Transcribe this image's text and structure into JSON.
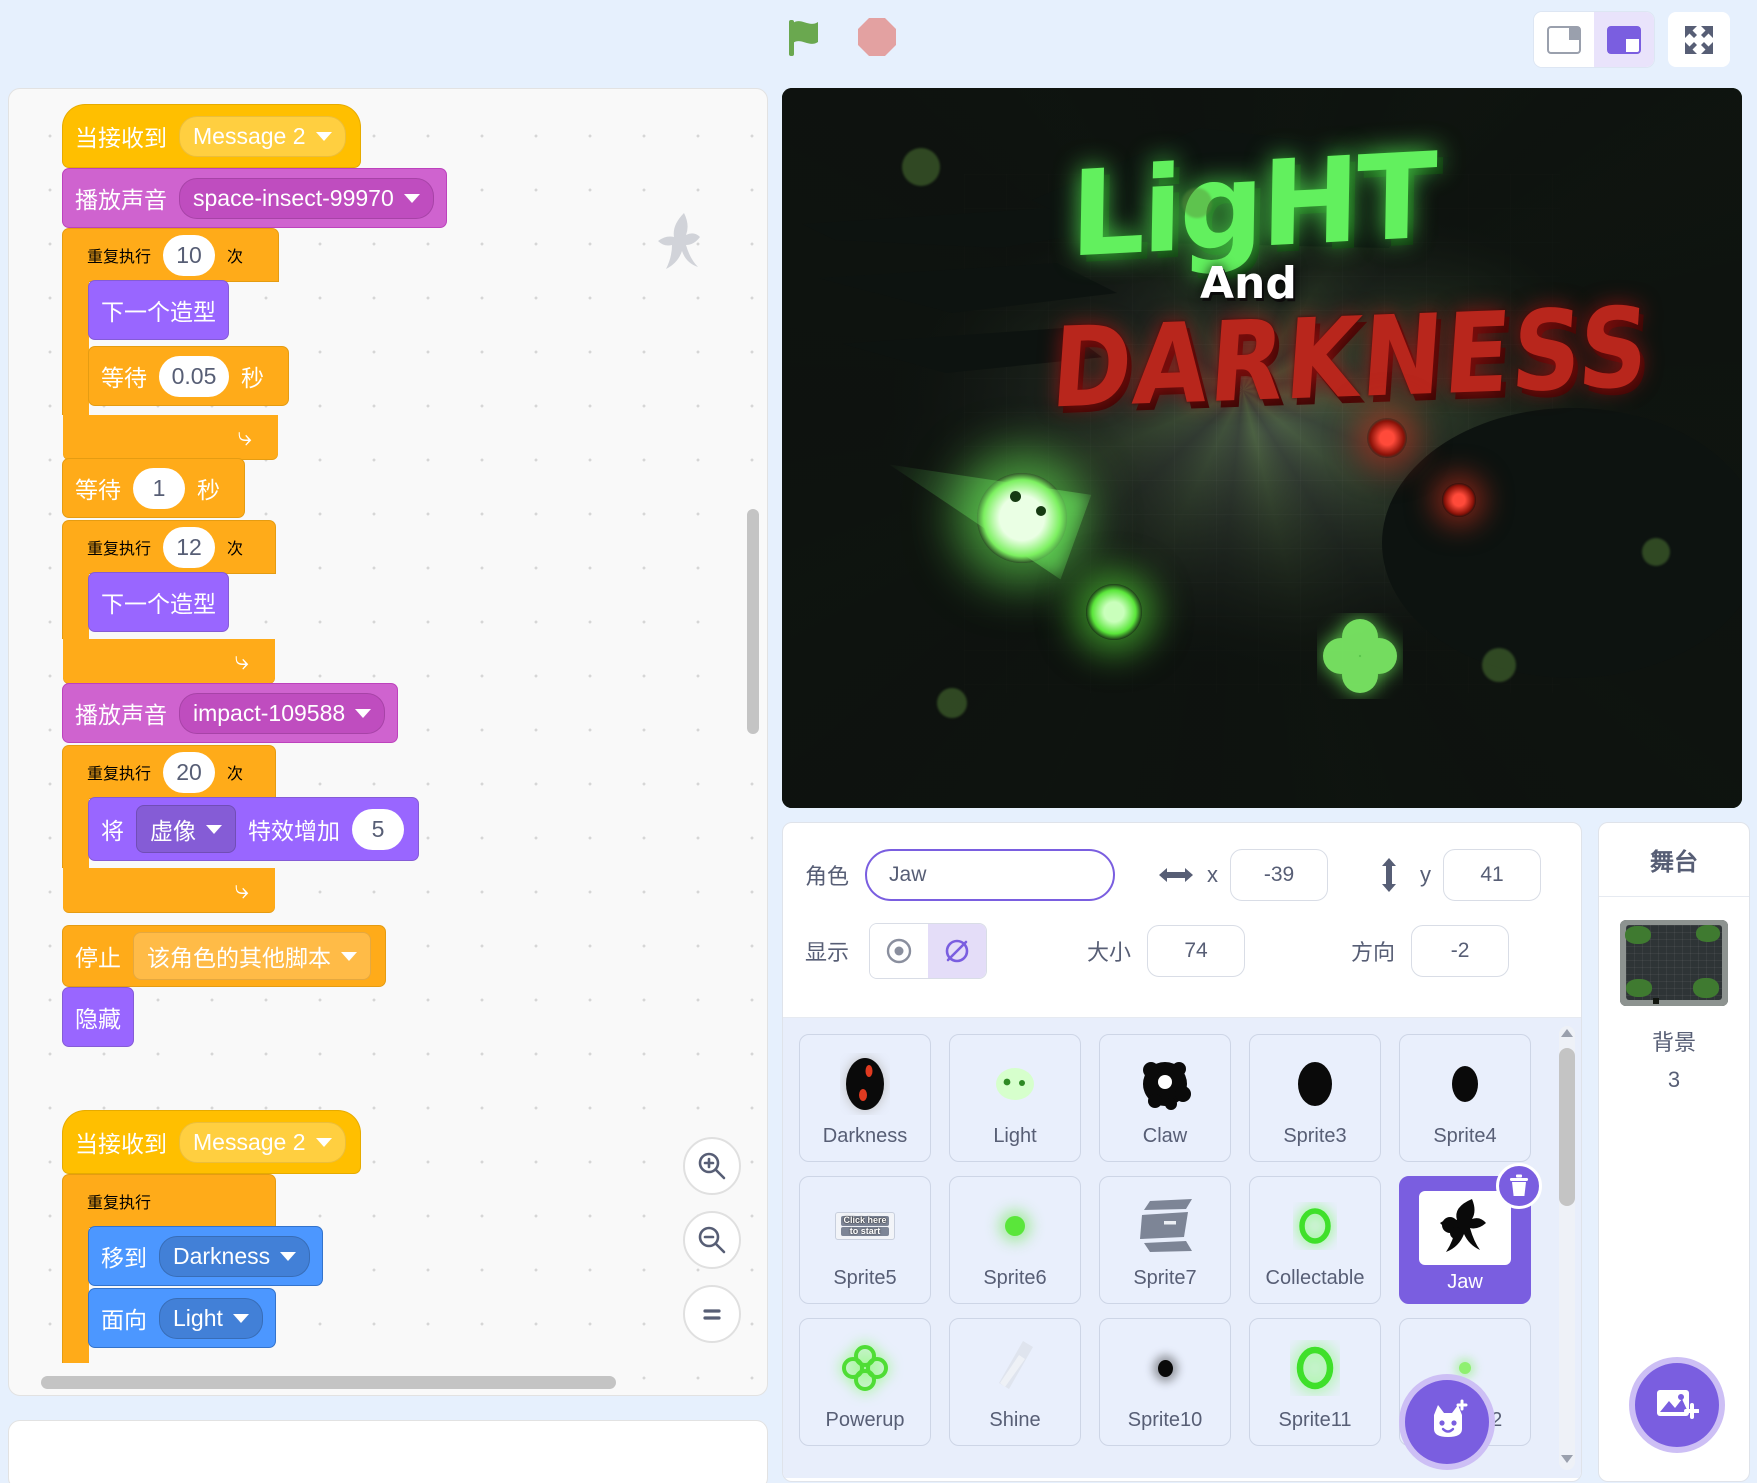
{
  "toolbar": {
    "green_flag": "green-flag",
    "stop": "stop-sign",
    "small_stage": "small-stage-layout",
    "large_stage": "large-stage-layout",
    "fullscreen": "fullscreen"
  },
  "code": {
    "scripts": [
      {
        "blocks": [
          {
            "type": "hat",
            "label": "当接收到",
            "dropdown": "Message 2"
          },
          {
            "type": "sound",
            "label": "播放声音",
            "dropdown": "space-insect-99970"
          },
          {
            "type": "c_repeat",
            "label": "重复执行",
            "value": "10",
            "suffix": "次",
            "children": [
              {
                "type": "looks",
                "label": "下一个造型"
              },
              {
                "type": "control_wait",
                "label": "等待",
                "value": "0.05",
                "suffix": "秒"
              }
            ]
          },
          {
            "type": "control_wait",
            "label": "等待",
            "value": "1",
            "suffix": "秒"
          },
          {
            "type": "c_repeat",
            "label": "重复执行",
            "value": "12",
            "suffix": "次",
            "children": [
              {
                "type": "looks",
                "label": "下一个造型"
              }
            ]
          },
          {
            "type": "sound",
            "label": "播放声音",
            "dropdown": "impact-109588"
          },
          {
            "type": "c_repeat",
            "label": "重复执行",
            "value": "20",
            "suffix": "次",
            "children": [
              {
                "type": "looks_effect",
                "prefix": "将",
                "dropdown": "虚像",
                "mid": "特效增加",
                "value": "5"
              }
            ]
          },
          {
            "type": "control_stop",
            "label": "停止",
            "dropdown": "该角色的其他脚本"
          },
          {
            "type": "looks",
            "label": "隐藏"
          }
        ]
      },
      {
        "blocks": [
          {
            "type": "hat",
            "label": "当接收到",
            "dropdown": "Message 2"
          },
          {
            "type": "c_forever",
            "label": "重复执行",
            "children": [
              {
                "type": "motion",
                "label": "移到",
                "dropdown": "Darkness"
              },
              {
                "type": "motion",
                "label": "面向",
                "dropdown": "Light"
              }
            ]
          }
        ]
      }
    ],
    "zoom_in": "zoom-in",
    "zoom_out": "zoom-out",
    "zoom_reset": "zoom-reset"
  },
  "stage": {
    "title_light": "LigHT",
    "title_and": "And",
    "title_dark": "DARKNESS"
  },
  "sprite_info": {
    "name_label": "角色",
    "name_value": "Jaw",
    "x_label": "x",
    "x_value": "-39",
    "y_label": "y",
    "y_value": "41",
    "show_label": "显示",
    "size_label": "大小",
    "size_value": "74",
    "direction_label": "方向",
    "direction_value": "-2",
    "visible_selected": "hidden"
  },
  "sprites": [
    {
      "name": "Darkness",
      "thumb": "dark-eye",
      "selected": false
    },
    {
      "name": "Light",
      "thumb": "light-eyes",
      "selected": false
    },
    {
      "name": "Claw",
      "thumb": "claw-black",
      "selected": false
    },
    {
      "name": "Sprite3",
      "thumb": "black-oval",
      "selected": false
    },
    {
      "name": "Sprite4",
      "thumb": "black-oval-sm",
      "selected": false
    },
    {
      "name": "Sprite5",
      "thumb": "click-to-start",
      "selected": false
    },
    {
      "name": "Sprite6",
      "thumb": "green-dot",
      "selected": false
    },
    {
      "name": "Sprite7",
      "thumb": "gray-ship",
      "selected": false
    },
    {
      "name": "Collectable",
      "thumb": "green-ring",
      "selected": false
    },
    {
      "name": "Jaw",
      "thumb": "jaw-figure",
      "selected": true
    },
    {
      "name": "Powerup",
      "thumb": "green-clover",
      "selected": false
    },
    {
      "name": "Shine",
      "thumb": "gray-streak",
      "selected": false
    },
    {
      "name": "Sprite10",
      "thumb": "small-black",
      "selected": false
    },
    {
      "name": "Sprite11",
      "thumb": "green-ring-lg",
      "selected": false
    },
    {
      "name": "Sprite12",
      "thumb": "tiny-green",
      "selected": false
    }
  ],
  "sprite_actions": {
    "delete": "delete-sprite",
    "add_sprite": "add-sprite"
  },
  "stage_panel": {
    "header": "舞台",
    "backdrop_label": "背景",
    "backdrop_count": "3",
    "add_backdrop": "add-backdrop"
  },
  "colors": {
    "accent": "#7a5ee0",
    "events": "#ffbf00",
    "control": "#ffab19",
    "looks": "#9966ff",
    "sound": "#cf63cf",
    "motion": "#4c97ff"
  }
}
